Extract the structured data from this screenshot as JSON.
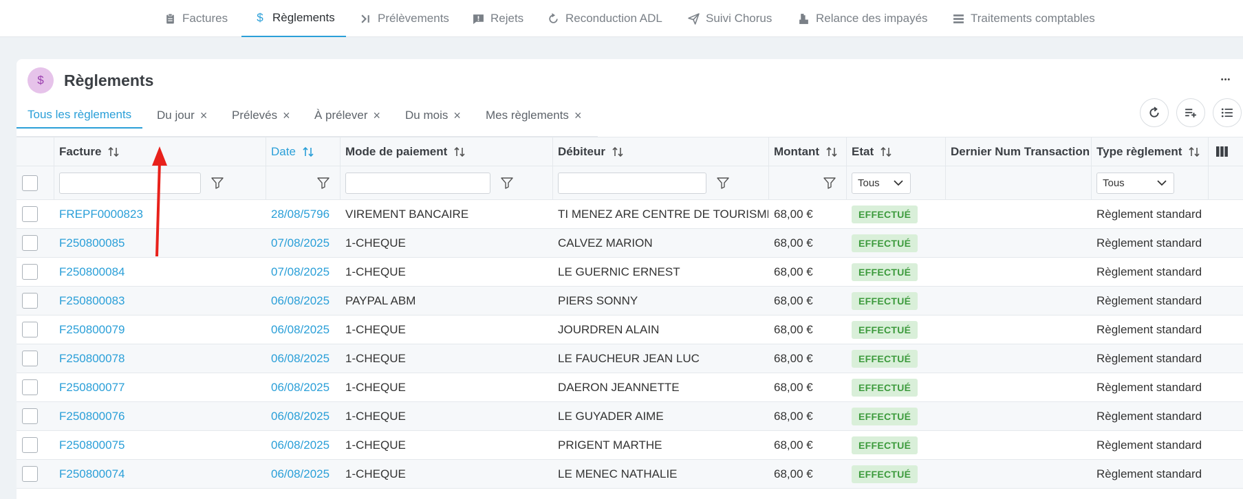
{
  "topnav": {
    "items": [
      {
        "label": "Factures",
        "icon": "clipboard-icon"
      },
      {
        "label": "Règlements",
        "icon": "dollar-icon"
      },
      {
        "label": "Prélèvements",
        "icon": "chevron-bar-icon"
      },
      {
        "label": "Rejets",
        "icon": "alert-message-icon"
      },
      {
        "label": "Reconduction ADL",
        "icon": "refresh-icon"
      },
      {
        "label": "Suivi Chorus",
        "icon": "paper-plane-icon"
      },
      {
        "label": "Relance des impayés",
        "icon": "stamp-icon"
      },
      {
        "label": "Traitements comptables",
        "icon": "list-icon"
      }
    ]
  },
  "header": {
    "title": "Règlements",
    "icon_glyph": "$"
  },
  "tabs": [
    {
      "label": "Tous les règlements"
    },
    {
      "label": "Du jour"
    },
    {
      "label": "Prélevés"
    },
    {
      "label": "À prélever"
    },
    {
      "label": "Du mois"
    },
    {
      "label": "Mes règlements"
    }
  ],
  "tab_close_glyph": "×",
  "more_glyph": "•••",
  "table": {
    "columns": {
      "facture": "Facture",
      "date": "Date",
      "mode": "Mode de paiement",
      "debiteur": "Débiteur",
      "montant": "Montant",
      "etat": "Etat",
      "dernier": "Dernier Num Transaction",
      "type": "Type règlement"
    },
    "filters": {
      "etat": "Tous",
      "type": "Tous"
    },
    "rows": [
      {
        "facture": "FREPF0000823",
        "date": "28/08/5796",
        "mode": "VIREMENT BANCAIRE",
        "debiteur": "TI MENEZ ARE CENTRE DE TOURISME",
        "montant": "68,00 €",
        "etat": "EFFECTUÉ",
        "dernier": "",
        "type": "Règlement standard"
      },
      {
        "facture": "F250800085",
        "date": "07/08/2025",
        "mode": "1-CHEQUE",
        "debiteur": "CALVEZ MARION",
        "montant": "68,00 €",
        "etat": "EFFECTUÉ",
        "dernier": "",
        "type": "Règlement standard"
      },
      {
        "facture": "F250800084",
        "date": "07/08/2025",
        "mode": "1-CHEQUE",
        "debiteur": "LE GUERNIC ERNEST",
        "montant": "68,00 €",
        "etat": "EFFECTUÉ",
        "dernier": "",
        "type": "Règlement standard"
      },
      {
        "facture": "F250800083",
        "date": "06/08/2025",
        "mode": "PAYPAL ABM",
        "debiteur": "PIERS SONNY",
        "montant": "68,00 €",
        "etat": "EFFECTUÉ",
        "dernier": "",
        "type": "Règlement standard"
      },
      {
        "facture": "F250800079",
        "date": "06/08/2025",
        "mode": "1-CHEQUE",
        "debiteur": "JOURDREN ALAIN",
        "montant": "68,00 €",
        "etat": "EFFECTUÉ",
        "dernier": "",
        "type": "Règlement standard"
      },
      {
        "facture": "F250800078",
        "date": "06/08/2025",
        "mode": "1-CHEQUE",
        "debiteur": "LE FAUCHEUR JEAN LUC",
        "montant": "68,00 €",
        "etat": "EFFECTUÉ",
        "dernier": "",
        "type": "Règlement standard"
      },
      {
        "facture": "F250800077",
        "date": "06/08/2025",
        "mode": "1-CHEQUE",
        "debiteur": "DAERON JEANNETTE",
        "montant": "68,00 €",
        "etat": "EFFECTUÉ",
        "dernier": "",
        "type": "Règlement standard"
      },
      {
        "facture": "F250800076",
        "date": "06/08/2025",
        "mode": "1-CHEQUE",
        "debiteur": "LE GUYADER AIME",
        "montant": "68,00 €",
        "etat": "EFFECTUÉ",
        "dernier": "",
        "type": "Règlement standard"
      },
      {
        "facture": "F250800075",
        "date": "06/08/2025",
        "mode": "1-CHEQUE",
        "debiteur": "PRIGENT MARTHE",
        "montant": "68,00 €",
        "etat": "EFFECTUÉ",
        "dernier": "",
        "type": "Règlement standard"
      },
      {
        "facture": "F250800074",
        "date": "06/08/2025",
        "mode": "1-CHEQUE",
        "debiteur": "LE MENEC NATHALIE",
        "montant": "68,00 €",
        "etat": "EFFECTUÉ",
        "dernier": "",
        "type": "Règlement standard"
      }
    ]
  },
  "colors": {
    "accent": "#2a9fd8",
    "success_bg": "#d9efd9",
    "success_text": "#3c9a3c",
    "annotation_arrow": "#e8211b"
  }
}
